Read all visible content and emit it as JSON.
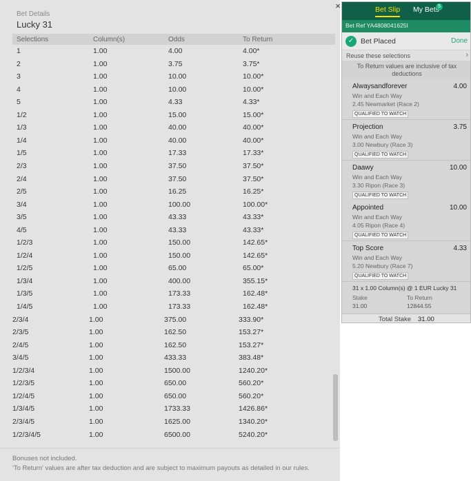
{
  "details": {
    "label": "Bet Details",
    "title": "Lucky 31",
    "columns": [
      "Selections",
      "Column(s)",
      "Odds",
      "To Return"
    ],
    "rows": [
      [
        "1",
        "1.00",
        "4.00",
        "4.00*"
      ],
      [
        "2",
        "1.00",
        "3.75",
        "3.75*"
      ],
      [
        "3",
        "1.00",
        "10.00",
        "10.00*"
      ],
      [
        "4",
        "1.00",
        "10.00",
        "10.00*"
      ],
      [
        "5",
        "1.00",
        "4.33",
        "4.33*"
      ],
      [
        "1/2",
        "1.00",
        "15.00",
        "15.00*"
      ],
      [
        "1/3",
        "1.00",
        "40.00",
        "40.00*"
      ],
      [
        "1/4",
        "1.00",
        "40.00",
        "40.00*"
      ],
      [
        "1/5",
        "1.00",
        "17.33",
        "17.33*"
      ],
      [
        "2/3",
        "1.00",
        "37.50",
        "37.50*"
      ],
      [
        "2/4",
        "1.00",
        "37.50",
        "37.50*"
      ],
      [
        "2/5",
        "1.00",
        "16.25",
        "16.25*"
      ],
      [
        "3/4",
        "1.00",
        "100.00",
        "100.00*"
      ],
      [
        "3/5",
        "1.00",
        "43.33",
        "43.33*"
      ],
      [
        "4/5",
        "1.00",
        "43.33",
        "43.33*"
      ],
      [
        "1/2/3",
        "1.00",
        "150.00",
        "142.65*"
      ],
      [
        "1/2/4",
        "1.00",
        "150.00",
        "142.65*"
      ],
      [
        "1/2/5",
        "1.00",
        "65.00",
        "65.00*"
      ],
      [
        "1/3/4",
        "1.00",
        "400.00",
        "355.15*"
      ],
      [
        "1/3/5",
        "1.00",
        "173.33",
        "162.48*"
      ],
      [
        "1/4/5",
        "1.00",
        "173.33",
        "162.48*"
      ],
      [
        "2/3/4",
        "1.00",
        "375.00",
        "333.90*"
      ],
      [
        "2/3/5",
        "1.00",
        "162.50",
        "153.27*"
      ],
      [
        "2/4/5",
        "1.00",
        "162.50",
        "153.27*"
      ],
      [
        "3/4/5",
        "1.00",
        "433.33",
        "383.48*"
      ],
      [
        "1/2/3/4",
        "1.00",
        "1500.00",
        "1240.20*"
      ],
      [
        "1/2/3/5",
        "1.00",
        "650.00",
        "560.20*"
      ],
      [
        "1/2/4/5",
        "1.00",
        "650.00",
        "560.20*"
      ],
      [
        "1/3/4/5",
        "1.00",
        "1733.33",
        "1426.86*"
      ],
      [
        "2/3/4/5",
        "1.00",
        "1625.00",
        "1340.20*"
      ],
      [
        "1/2/3/4/5",
        "1.00",
        "6500.00",
        "5240.20*"
      ]
    ],
    "note_bonuses": "Bonuses not included.",
    "note_tax": "'To Return' values are after tax deduction and are subject to maximum payouts as detailed in our rules.",
    "close_glyph": "×"
  },
  "slip": {
    "tabs": {
      "bet_slip": "Bet Slip",
      "my_bets": "My Bets",
      "my_bets_count": "5"
    },
    "bet_ref": "Bet Ref YA4808041625I",
    "placed_label": "Bet Placed",
    "check_glyph": "✓",
    "done_label": "Done",
    "reuse_label": "Reuse these selections",
    "reuse_chevron": "›",
    "tax_note": "To Return values are inclusive of tax deductions",
    "selections": [
      {
        "name": "Alwaysandforever",
        "odds": "4.00",
        "market": "Win and Each Way",
        "race": "2.45 Newmarket (Race 2)",
        "badge": "QUALIFIED TO WATCH"
      },
      {
        "name": "Projection",
        "odds": "3.75",
        "market": "Win and Each Way",
        "race": "3.00 Newbury (Race 3)",
        "badge": "QUALIFIED TO WATCH"
      },
      {
        "name": "Daawy",
        "odds": "10.00",
        "market": "Win and Each Way",
        "race": "3.30 Ripon (Race 3)",
        "badge": "QUALIFIED TO WATCH"
      },
      {
        "name": "Appointed",
        "odds": "10.00",
        "market": "Win and Each Way",
        "race": "4.05 Ripon (Race 4)",
        "badge": "QUALIFIED TO WATCH"
      },
      {
        "name": "Top Score",
        "odds": "4.33",
        "market": "Win and Each Way",
        "race": "5.20 Newbury (Race 7)",
        "badge": "QUALIFIED TO WATCH"
      }
    ],
    "summary": {
      "line": "31 x 1.00 Column(s) @ 1 EUR Lucky 31",
      "stake_label": "Stake",
      "return_label": "To Return",
      "stake_value": "31.00",
      "return_value": "12844.55"
    },
    "total": {
      "label": "Total Stake",
      "value": "31.00"
    },
    "colors": {
      "header_dark": "#105f47",
      "header_mid": "#1e8b64",
      "accent_yellow": "#ffde00",
      "success_green": "#16a877"
    }
  }
}
